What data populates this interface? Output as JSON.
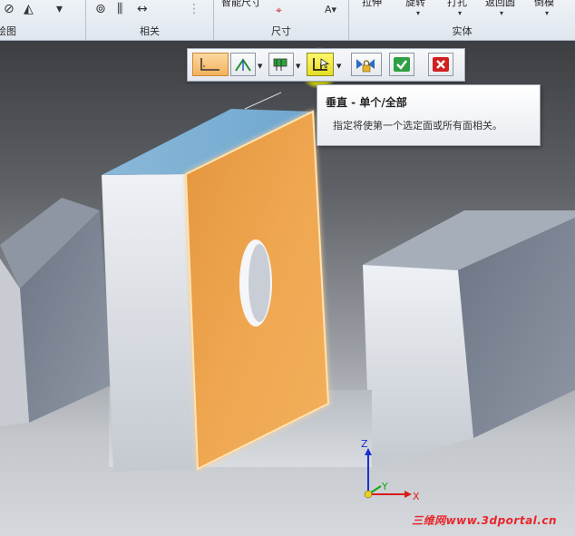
{
  "ribbon": {
    "groups": [
      {
        "label": "绘图"
      },
      {
        "label": "相关"
      },
      {
        "label": "尺寸",
        "top_text": "智能尺寸"
      },
      {
        "label": "实体",
        "top_items": [
          "拉伸",
          "旋转",
          "打孔",
          "返回圆",
          "倒模"
        ]
      }
    ]
  },
  "commandbar": {
    "buttons": [
      {
        "name": "horizontal-vertical",
        "state": "active"
      },
      {
        "name": "symmetric"
      },
      {
        "name": "tangent"
      },
      {
        "name": "perpendicular",
        "state": "hover"
      },
      {
        "name": "lock"
      },
      {
        "name": "accept"
      },
      {
        "name": "cancel"
      }
    ]
  },
  "tooltip": {
    "title": "垂直 - 单个/全部",
    "description": "指定将使第一个选定面或所有面相关。"
  },
  "triad": {
    "x": "X",
    "y": "Y",
    "z": "Z"
  },
  "watermark": "三维网www.3dportal.cn",
  "colors": {
    "selected_face": "#f0a64a",
    "top_face": "#7fb2d4",
    "accept": "#2ea043",
    "cancel": "#d12020",
    "highlight": "#f2f200"
  }
}
